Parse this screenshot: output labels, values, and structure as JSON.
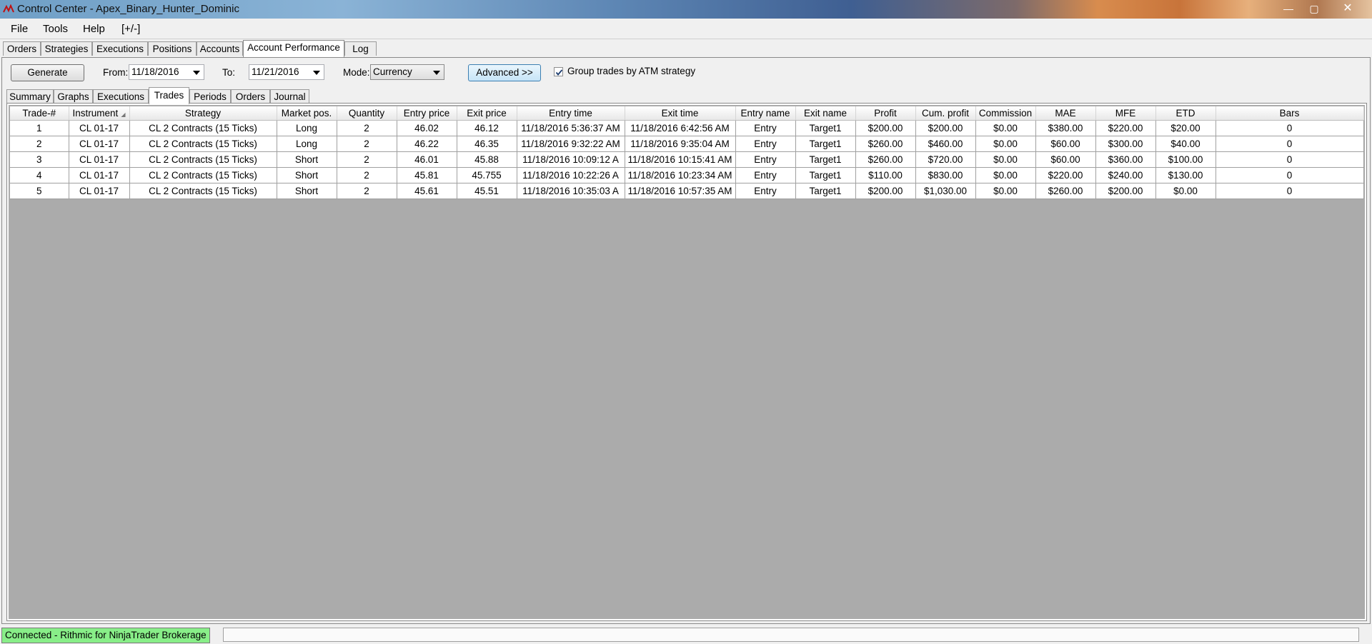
{
  "window": {
    "title": "Control Center - Apex_Binary_Hunter_Dominic",
    "minimize": "—",
    "maximize": "▢",
    "close": "✕"
  },
  "menu": [
    "File",
    "Tools",
    "Help",
    "[+/-]"
  ],
  "main_tabs": [
    "Orders",
    "Strategies",
    "Executions",
    "Positions",
    "Accounts",
    "Account Performance",
    "Log"
  ],
  "toolbar": {
    "generate_label": "Generate",
    "from_label": "From:",
    "from_value": "11/18/2016",
    "to_label": "To:",
    "to_value": "11/21/2016",
    "mode_label": "Mode:",
    "mode_value": "Currency",
    "advanced_label": "Advanced >>",
    "group_label": "Group trades by ATM strategy",
    "group_checked": true
  },
  "sub_tabs": [
    "Summary",
    "Graphs",
    "Executions",
    "Trades",
    "Periods",
    "Orders",
    "Journal"
  ],
  "table": {
    "columns": [
      "Trade-#",
      "Instrument",
      "Strategy",
      "Market pos.",
      "Quantity",
      "Entry price",
      "Exit price",
      "Entry time",
      "Exit time",
      "Entry name",
      "Exit name",
      "Profit",
      "Cum. profit",
      "Commission",
      "MAE",
      "MFE",
      "ETD",
      "Bars"
    ],
    "rows": [
      [
        "1",
        "CL 01-17",
        "CL 2 Contracts (15 Ticks)",
        "Long",
        "2",
        "46.02",
        "46.12",
        "11/18/2016 5:36:37 AM",
        "11/18/2016 6:42:56 AM",
        "Entry",
        "Target1",
        "$200.00",
        "$200.00",
        "$0.00",
        "$380.00",
        "$220.00",
        "$20.00",
        "0"
      ],
      [
        "2",
        "CL 01-17",
        "CL 2 Contracts (15 Ticks)",
        "Long",
        "2",
        "46.22",
        "46.35",
        "11/18/2016 9:32:22 AM",
        "11/18/2016 9:35:04 AM",
        "Entry",
        "Target1",
        "$260.00",
        "$460.00",
        "$0.00",
        "$60.00",
        "$300.00",
        "$40.00",
        "0"
      ],
      [
        "3",
        "CL 01-17",
        "CL 2 Contracts (15 Ticks)",
        "Short",
        "2",
        "46.01",
        "45.88",
        "11/18/2016 10:09:12 A",
        "11/18/2016 10:15:41 AM",
        "Entry",
        "Target1",
        "$260.00",
        "$720.00",
        "$0.00",
        "$60.00",
        "$360.00",
        "$100.00",
        "0"
      ],
      [
        "4",
        "CL 01-17",
        "CL 2 Contracts (15 Ticks)",
        "Short",
        "2",
        "45.81",
        "45.755",
        "11/18/2016 10:22:26 A",
        "11/18/2016 10:23:34 AM",
        "Entry",
        "Target1",
        "$110.00",
        "$830.00",
        "$0.00",
        "$220.00",
        "$240.00",
        "$130.00",
        "0"
      ],
      [
        "5",
        "CL 01-17",
        "CL 2 Contracts (15 Ticks)",
        "Short",
        "2",
        "45.61",
        "45.51",
        "11/18/2016 10:35:03 A",
        "11/18/2016 10:57:35 AM",
        "Entry",
        "Target1",
        "$200.00",
        "$1,030.00",
        "$0.00",
        "$260.00",
        "$200.00",
        "$0.00",
        "0"
      ]
    ]
  },
  "status": {
    "connection": "Connected - Rithmic for NinjaTrader Brokerage"
  },
  "colors": {
    "status_connected": "#88ee88",
    "grid_background": "#ababab"
  }
}
